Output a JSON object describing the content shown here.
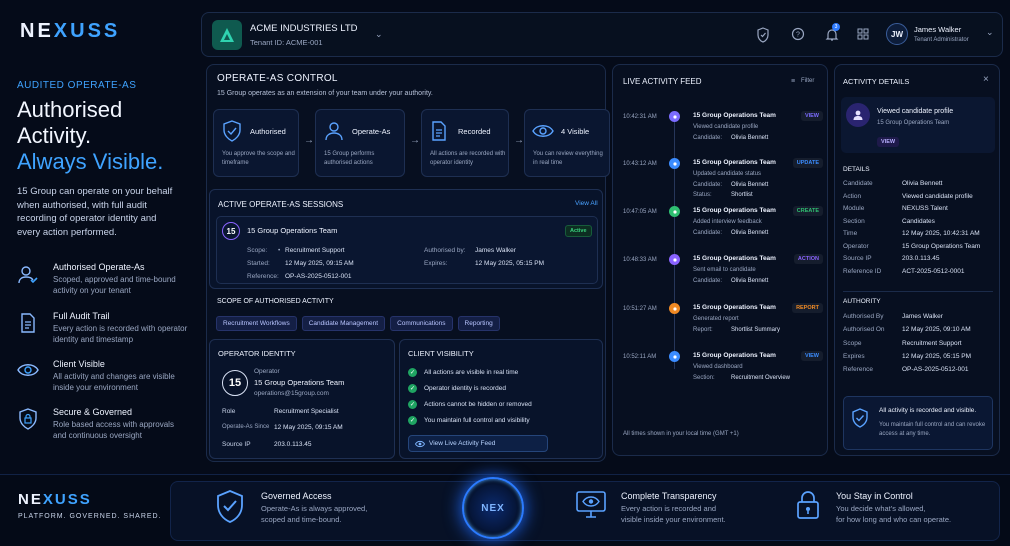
{
  "brand": {
    "logo_left": "NE",
    "logo_mid": "X",
    "logo_right": "USS",
    "tagline": "PLATFORM. GOVERNED. SHARED."
  },
  "tenant": {
    "name": "ACME INDUSTRIES LTD",
    "id": "Tenant ID: ACME-001"
  },
  "topbar": {
    "notif_count": "3",
    "user_initials": "JW",
    "user_name": "James Walker",
    "user_role": "Tenant Administrator"
  },
  "hero": {
    "eyebrow": "AUDITED OPERATE-AS",
    "line1": "Authorised",
    "line2": "Activity.",
    "line3": "Always Visible.",
    "desc": "15 Group can operate on your behalf when authorised, with full audit recording of operator identity and every action performed.",
    "features": [
      {
        "title": "Authorised Operate-As",
        "desc": "Scoped, approved and time-bound activity on your tenant"
      },
      {
        "title": "Full Audit Trail",
        "desc": "Every action is recorded with operator identity and timestamp"
      },
      {
        "title": "Client Visible",
        "desc": "All activity and changes are visible inside your environment"
      },
      {
        "title": "Secure & Governed",
        "desc": "Role based access with approvals and continuous oversight"
      }
    ]
  },
  "control": {
    "title": "OPERATE-AS CONTROL",
    "subtitle": "15 Group operates as an extension of your team under your authority.",
    "steps": [
      {
        "title": "Authorised",
        "desc": "You approve the scope and timeframe"
      },
      {
        "title": "Operate-As",
        "desc": "15 Group performs authorised actions"
      },
      {
        "title": "Recorded",
        "desc": "All actions are recorded with operator identity"
      },
      {
        "title": "4 Visible",
        "desc": "You can review everything in real time"
      }
    ]
  },
  "sessions": {
    "title": "ACTIVE OPERATE-AS SESSIONS",
    "view_all": "View All",
    "badge": "15",
    "team": "15 Group Operations Team",
    "status": "Active",
    "scope_label": "Scope:",
    "scope_value": "Recruitment Support",
    "started_label": "Started:",
    "started_value": "12 May 2025, 09:15 AM",
    "ref_label": "Reference:",
    "ref_value": "OP-AS-2025-0512-001",
    "auth_label": "Authorised by:",
    "auth_value": "James Walker",
    "expires_label": "Expires:",
    "expires_value": "12 May 2025, 05:15 PM"
  },
  "scope": {
    "title": "SCOPE OF AUTHORISED ACTIVITY",
    "chips": [
      "Recruitment Workflows",
      "Candidate Management",
      "Communications",
      "Reporting"
    ]
  },
  "operator": {
    "title": "OPERATOR IDENTITY",
    "badge": "15",
    "label": "Operator",
    "team": "15 Group Operations Team",
    "email": "operations@15group.com",
    "role_label": "Role",
    "role_value": "Recruitment Specialist",
    "since_label": "Operate-As Since",
    "since_value": "12 May 2025, 09:15 AM",
    "ip_label": "Source IP",
    "ip_value": "203.0.113.45"
  },
  "client": {
    "title": "CLIENT VISIBILITY",
    "items": [
      "All actions are visible in real time",
      "Operator identity is recorded",
      "Actions cannot be hidden or removed",
      "You maintain full control and visibility"
    ],
    "button": "View Live Activity Feed"
  },
  "feed": {
    "title": "LIVE ACTIVITY FEED",
    "filter": "Filter",
    "footer": "All times shown in your local time (GMT +1)",
    "items": [
      {
        "time": "10:42:31 AM",
        "team": "15 Group Operations Team",
        "action": "Viewed candidate profile",
        "k1": "Candidate:",
        "v1": "Olivia Bennett",
        "k2": "",
        "v2": "",
        "tag": "VIEW",
        "color": "#7b6cff"
      },
      {
        "time": "10:43:12 AM",
        "team": "15 Group Operations Team",
        "action": "Updated candidate status",
        "k1": "Candidate:",
        "v1": "Olivia Bennett",
        "k2": "Status:",
        "v2": "Shortlist",
        "tag": "UPDATE",
        "color": "#3b8cff"
      },
      {
        "time": "10:47:05 AM",
        "team": "15 Group Operations Team",
        "action": "Added interview feedback",
        "k1": "Candidate:",
        "v1": "Olivia Bennett",
        "k2": "",
        "v2": "",
        "tag": "CREATE",
        "color": "#2fbf71"
      },
      {
        "time": "10:48:33 AM",
        "team": "15 Group Operations Team",
        "action": "Sent email to candidate",
        "k1": "Candidate:",
        "v1": "Olivia Bennett",
        "k2": "",
        "v2": "",
        "tag": "ACTION",
        "color": "#8a63ff"
      },
      {
        "time": "10:51:27 AM",
        "team": "15 Group Operations Team",
        "action": "Generated report",
        "k1": "Report:",
        "v1": "Shortlist Summary",
        "k2": "",
        "v2": "",
        "tag": "REPORT",
        "color": "#f08a24"
      },
      {
        "time": "10:52:11 AM",
        "team": "15 Group Operations Team",
        "action": "Viewed dashboard",
        "k1": "Section:",
        "v1": "Recruitment Overview",
        "k2": "",
        "v2": "",
        "tag": "VIEW",
        "color": "#3b8cff"
      }
    ]
  },
  "details": {
    "title": "ACTIVITY DETAILS",
    "head_action": "Viewed candidate profile",
    "head_team": "15 Group Operations Team",
    "head_tag": "VIEW",
    "details_title": "DETAILS",
    "rows": [
      [
        "Candidate",
        "Olivia Bennett"
      ],
      [
        "Action",
        "Viewed candidate profile"
      ],
      [
        "Module",
        "NEXUSS Talent"
      ],
      [
        "Section",
        "Candidates"
      ],
      [
        "Time",
        "12 May 2025, 10:42:31 AM"
      ],
      [
        "Operator",
        "15 Group Operations Team"
      ],
      [
        "Source IP",
        "203.0.113.45"
      ],
      [
        "Reference ID",
        "ACT-2025-0512-0001"
      ]
    ],
    "authority_title": "AUTHORITY",
    "arows": [
      [
        "Authorised By",
        "James Walker"
      ],
      [
        "Authorised On",
        "12 May 2025, 09:10 AM"
      ],
      [
        "Scope",
        "Recruitment Support"
      ],
      [
        "Expires",
        "12 May 2025, 05:15 PM"
      ],
      [
        "Reference",
        "OP-AS-2025-0512-001"
      ]
    ],
    "note_title": "All activity is recorded and visible.",
    "note_desc": "You maintain full control and can revoke access at any time."
  },
  "footer": {
    "center": "NEX",
    "items": [
      {
        "title": "Governed Access",
        "desc1": "Operate-As is always approved,",
        "desc2": "scoped and time-bound."
      },
      {
        "title": "Complete Transparency",
        "desc1": "Every action is recorded and",
        "desc2": "visible inside your environment."
      },
      {
        "title": "You Stay in Control",
        "desc1": "You decide what's allowed,",
        "desc2": "for how long and who can operate."
      }
    ]
  }
}
